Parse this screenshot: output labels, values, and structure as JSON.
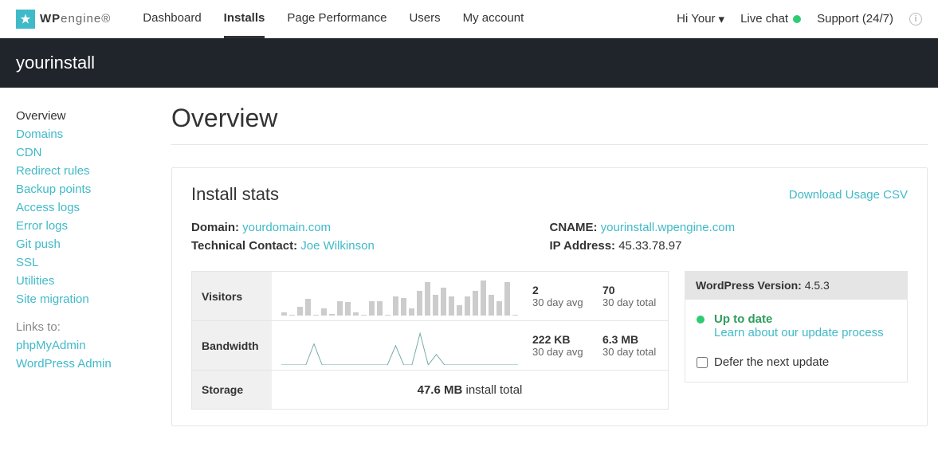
{
  "brand": {
    "name_a": "WP",
    "name_b": "engine"
  },
  "nav": {
    "items": [
      {
        "label": "Dashboard"
      },
      {
        "label": "Installs",
        "active": true
      },
      {
        "label": "Page Performance"
      },
      {
        "label": "Users"
      },
      {
        "label": "My account"
      }
    ],
    "greeting": "Hi Your",
    "livechat": "Live chat",
    "support": "Support (24/7)"
  },
  "subheader": "yourinstall",
  "sidebar": {
    "items": [
      {
        "label": "Overview",
        "active": true
      },
      {
        "label": "Domains"
      },
      {
        "label": "CDN"
      },
      {
        "label": "Redirect rules"
      },
      {
        "label": "Backup points"
      },
      {
        "label": "Access logs"
      },
      {
        "label": "Error logs"
      },
      {
        "label": "Git push"
      },
      {
        "label": "SSL"
      },
      {
        "label": "Utilities"
      },
      {
        "label": "Site migration"
      }
    ],
    "links_label": "Links to:",
    "links": [
      {
        "label": "phpMyAdmin"
      },
      {
        "label": "WordPress Admin"
      }
    ]
  },
  "page": {
    "title": "Overview"
  },
  "card": {
    "title": "Install stats",
    "download": "Download Usage CSV",
    "domain_label": "Domain:",
    "domain_value": "yourdomain.com",
    "contact_label": "Technical Contact:",
    "contact_value": "Joe Wilkinson",
    "cname_label": "CNAME:",
    "cname_value": "yourinstall.wpengine.com",
    "ip_label": "IP Address:",
    "ip_value": "45.33.78.97"
  },
  "stats": {
    "visitors": {
      "label": "Visitors",
      "avg": "2",
      "avg_sub": "30 day avg",
      "total": "70",
      "total_sub": "30 day total"
    },
    "bandwidth": {
      "label": "Bandwidth",
      "avg": "222 KB",
      "avg_sub": "30 day avg",
      "total": "6.3 MB",
      "total_sub": "30 day total"
    },
    "storage": {
      "label": "Storage",
      "value": "47.6 MB",
      "suffix": "install total"
    }
  },
  "wp": {
    "version_label": "WordPress Version:",
    "version": "4.5.3",
    "status": "Up to date",
    "learn": "Learn about our update process",
    "defer": "Defer the next update"
  },
  "chart_data": {
    "visitors_bars": [
      10,
      2,
      25,
      48,
      2,
      20,
      5,
      40,
      38,
      10,
      2,
      42,
      40,
      2,
      55,
      50,
      20,
      70,
      95,
      58,
      80,
      55,
      30,
      55,
      70,
      100,
      60,
      40,
      95,
      2
    ],
    "bandwidth_points": [
      0,
      0,
      0,
      0,
      60,
      0,
      0,
      0,
      0,
      0,
      0,
      0,
      0,
      0,
      55,
      0,
      0,
      90,
      0,
      30,
      0,
      0,
      0,
      0,
      0,
      0,
      0,
      0,
      0,
      0
    ]
  }
}
